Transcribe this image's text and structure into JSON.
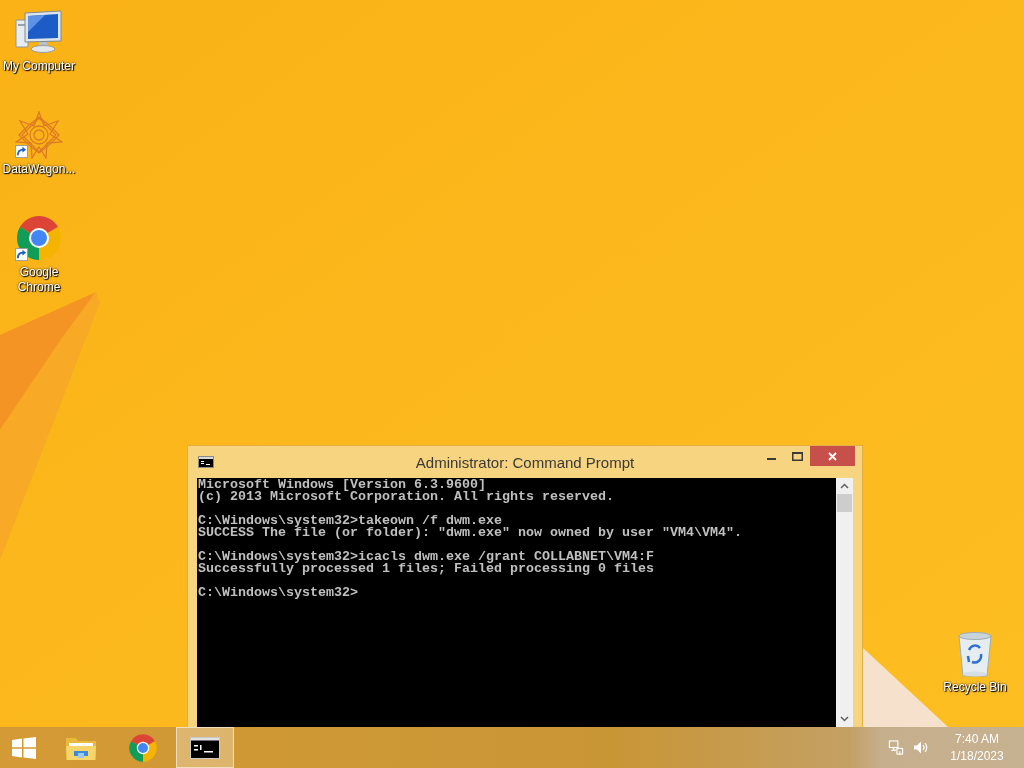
{
  "desktop_icons": [
    {
      "label": "My Computer",
      "kind": "computer",
      "shortcut": false
    },
    {
      "label": "DataWagon...",
      "kind": "emblem",
      "shortcut": true
    },
    {
      "label": "Google Chrome",
      "kind": "browser",
      "shortcut": true
    }
  ],
  "recycle_bin": {
    "label": "Recycle Bin"
  },
  "window": {
    "title": "Administrator: Command Prompt",
    "console": [
      [
        "Microsoft Windows [Version 6.3.9600]",
        "(c) 2013 Microsoft Corporation. All rights reserved."
      ],
      [
        "C:\\Windows\\system32>takeown /f dwm.exe",
        "SUCCESS The file (or folder): \"dwm.exe\" now owned by user \"VM4\\VM4\"."
      ],
      [
        "C:\\Windows\\system32>icacls dwm.exe /grant COLLABNET\\VM4:F",
        "Successfully processed 1 files; Failed processing 0 files"
      ],
      [
        "C:\\Windows\\system32>"
      ]
    ]
  },
  "taskbar": {
    "buttons": [
      {
        "kind": "start",
        "selected": false
      },
      {
        "kind": "folder",
        "selected": false
      },
      {
        "kind": "browser",
        "selected": false
      },
      {
        "kind": "console",
        "selected": true
      }
    ],
    "clock": {
      "time": "7:40 AM",
      "date": "1/18/2023"
    }
  }
}
